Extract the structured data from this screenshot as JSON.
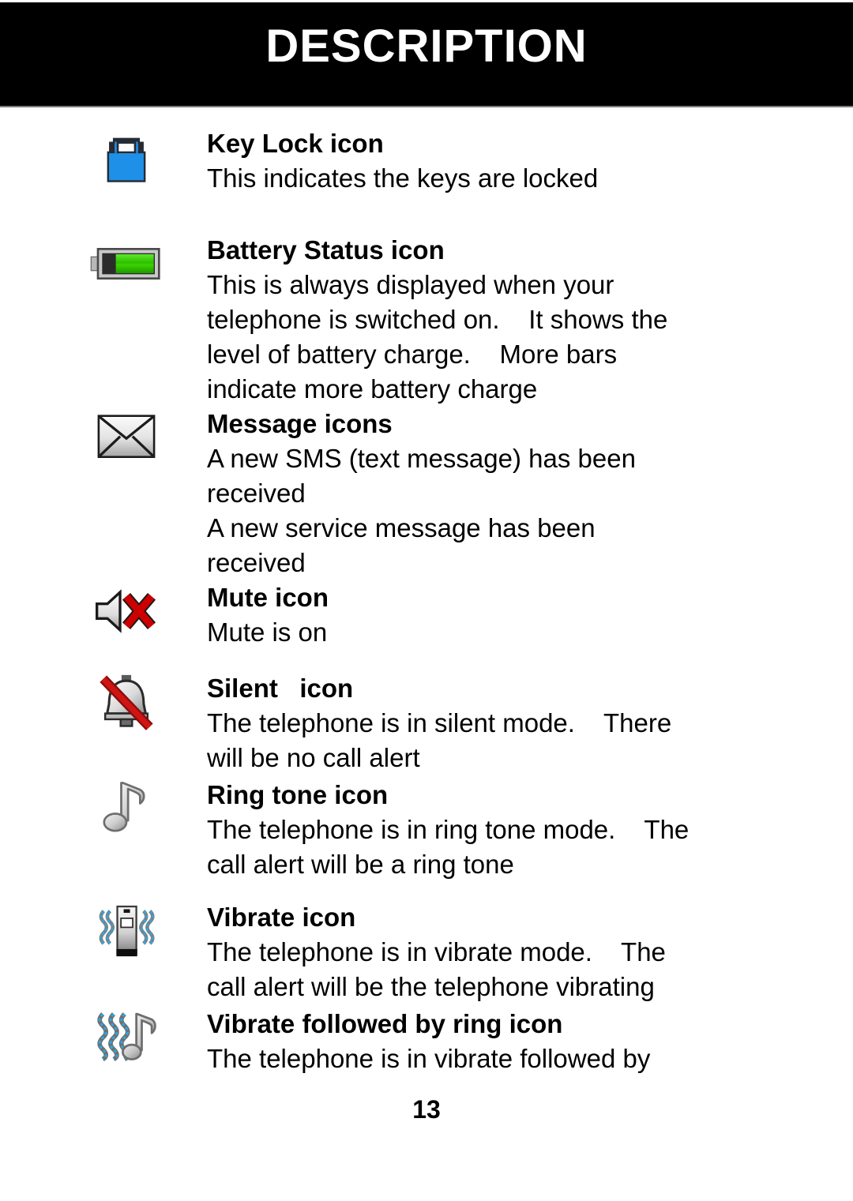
{
  "header": {
    "title": "DESCRIPTION"
  },
  "page": {
    "number": "13"
  },
  "entries": [
    {
      "icon": "key-lock-icon",
      "title": "Key Lock icon",
      "lines": [
        "This indicates the keys are locked"
      ]
    },
    {
      "icon": "battery-status-icon",
      "title": "Battery Status icon",
      "lines": [
        "This is always displayed when your",
        "telephone is switched on.    It shows the",
        "level of battery charge.    More bars",
        "indicate more battery charge"
      ]
    },
    {
      "icon": "message-envelope-icon",
      "title": "Message icons",
      "lines": [
        "A new SMS (text message) has been",
        "received",
        "A new service message has been",
        "received"
      ]
    },
    {
      "icon": "mute-icon",
      "title": "Mute icon",
      "lines": [
        "Mute is on"
      ]
    },
    {
      "icon": "silent-bell-icon",
      "title": "Silent   icon",
      "lines": [
        "The telephone is in silent mode.    There",
        "will be no call alert"
      ]
    },
    {
      "icon": "ring-tone-note-icon",
      "title": "Ring tone icon",
      "lines": [
        "The telephone is in ring tone mode.    The",
        "call alert will be a ring tone"
      ]
    },
    {
      "icon": "vibrate-icon",
      "title": "Vibrate icon",
      "lines": [
        "The telephone is in vibrate mode.    The",
        "call alert will be the telephone vibrating"
      ]
    },
    {
      "icon": "vibrate-then-ring-icon",
      "title": "Vibrate followed by ring icon",
      "lines": [
        "The telephone is in vibrate followed by"
      ]
    }
  ],
  "colors": {
    "header_background": "#000000",
    "header_text": "#ffffff",
    "body_text": "#000000",
    "lock_blue": "#1e90e8",
    "battery_green": "#33cc00",
    "mute_red": "#cc0000",
    "slash_red": "#d01414",
    "vibrate_blue": "#29a8e8"
  }
}
